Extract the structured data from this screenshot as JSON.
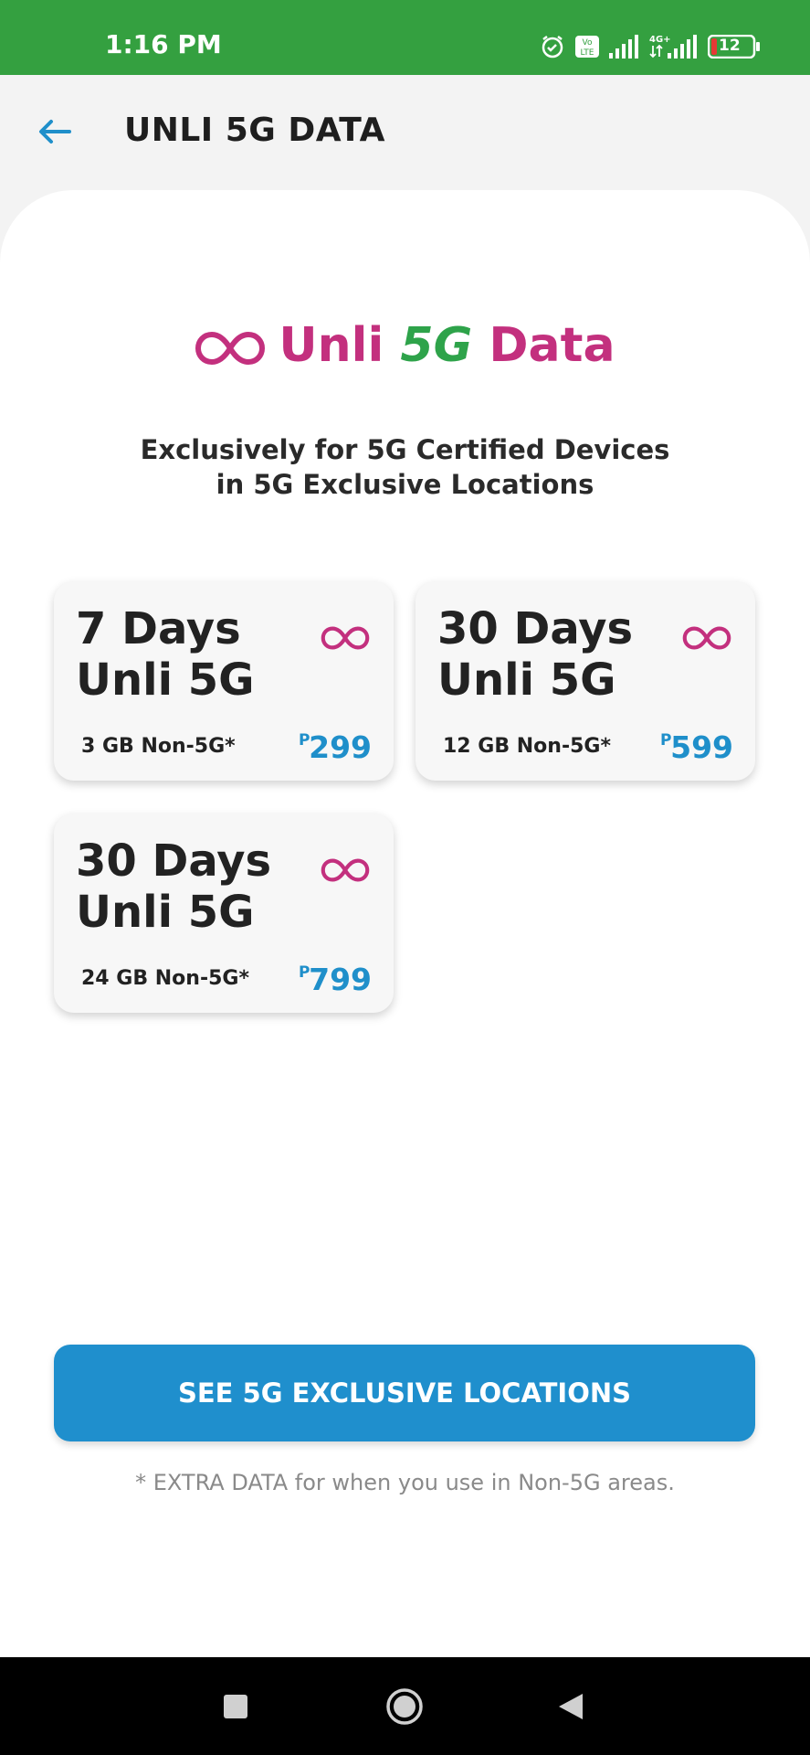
{
  "status_bar": {
    "time": "1:16 PM",
    "battery": "12",
    "network_label": "4G+",
    "volte_label": "Vo LTE"
  },
  "app_bar": {
    "title": "UNLI 5G DATA",
    "back_icon": "arrow-left-icon"
  },
  "hero": {
    "logo_prefix": "Unli ",
    "logo_highlight": "5G",
    "logo_suffix": " Data",
    "subtitle_line1": "Exclusively for 5G Certified Devices",
    "subtitle_line2": "in 5G Exclusive Locations"
  },
  "plans": [
    {
      "line1": "7 Days",
      "line2": "Unli 5G",
      "extra": "3 GB Non-5G*",
      "currency": "P",
      "price": "299"
    },
    {
      "line1": "30 Days",
      "line2": "Unli 5G",
      "extra": "12 GB Non-5G*",
      "currency": "P",
      "price": "599"
    },
    {
      "line1": "30 Days",
      "line2": "Unli 5G",
      "extra": "24 GB Non-5G*",
      "currency": "P",
      "price": "799"
    }
  ],
  "cta": {
    "label": "SEE 5G EXCLUSIVE LOCATIONS"
  },
  "footnote": "* EXTRA DATA for when you use in Non-5G areas.",
  "colors": {
    "status_bar": "#34a040",
    "brand_magenta": "#c3307e",
    "brand_green": "#2ea34a",
    "accent_blue": "#1f8fcd"
  }
}
